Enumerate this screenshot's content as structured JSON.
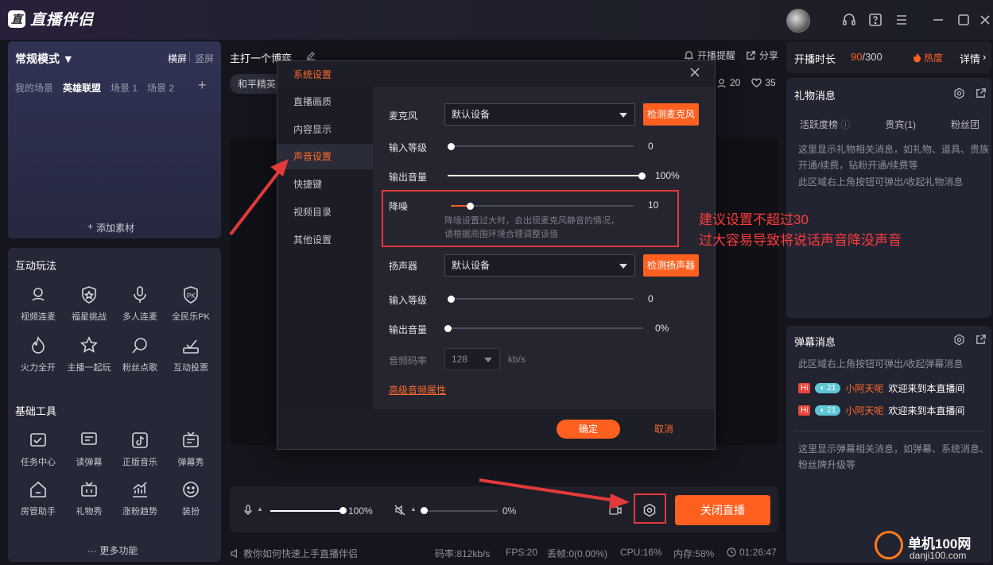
{
  "app": {
    "title": "直播伴侣",
    "logo_mark": "直"
  },
  "left": {
    "mode": "常规模式 ▼",
    "orient_landscape": "横屏",
    "orient_portrait": "竖屏",
    "scene_tabs": [
      "我的场景",
      "英雄联盟",
      "场景 1",
      "场景 2"
    ],
    "add_scene": "+",
    "add_material": "添加素材",
    "interactive_title": "互动玩法",
    "interactive_tools": [
      "视频连麦",
      "福星挑战",
      "多人连麦",
      "全民乐PK",
      "火力全开",
      "主播一起玩",
      "粉丝点歌",
      "互动投票"
    ],
    "basic_title": "基础工具",
    "basic_tools": [
      "任务中心",
      "读弹幕",
      "正版音乐",
      "弹幕秀",
      "房管助手",
      "礼物秀",
      "涨粉趋势",
      "装扮"
    ],
    "more": "··· 更多功能"
  },
  "center": {
    "stream_title": "主打一个博弈",
    "reminder": "开播提醒",
    "share": "分享",
    "tag": "和平精英",
    "viewers": "20",
    "likes": "35",
    "mic_volume": "100%",
    "speaker_volume": "0%",
    "close_live": "关闭直播",
    "status_tip": "教你如何快速上手直播伴侣",
    "bitrate": "码率:812kb/s",
    "fps": "FPS:20",
    "dropped": "丢帧:0(0.00%)",
    "cpu": "CPU:16%",
    "memory": "内存:58%",
    "time": "01:26:47"
  },
  "right": {
    "live_duration_label": "开播时长",
    "heat_value": "90",
    "heat_total": "/300",
    "heat_label": "热度",
    "details": "详情",
    "gift_title": "礼物消息",
    "gift_tabs": [
      "活跃度榜",
      "贵宾(1)",
      "粉丝团"
    ],
    "gift_text": "这里显示礼物相关消息，如礼物、道具、贵族开通/续费，钻粉开通/续费等",
    "gift_hint": "此区域右上角按钮可弹出/收起礼物消息",
    "danmu_title": "弹幕消息",
    "danmu_hint": "此区域右上角按钮可弹出/收起弹幕消息",
    "danmu_msgs": [
      {
        "badge": "Hi",
        "level": "21",
        "user": "小阿天呢",
        "text": "欢迎来到本直播间"
      },
      {
        "badge": "Hi",
        "level": "21",
        "user": "小阿天呢",
        "text": "欢迎来到本直播间"
      }
    ],
    "danmu_text": "这里显示弹幕相关消息，如弹幕、系统消息、粉丝牌升级等"
  },
  "dialog": {
    "title": "系统设置",
    "menu": [
      "直播画质",
      "内容显示",
      "声音设置",
      "快捷键",
      "视频目录",
      "其他设置"
    ],
    "mic_label": "麦克风",
    "mic_device": "默认设备",
    "detect_mic": "检测麦克风",
    "input_level_label": "输入等级",
    "mic_input_level": "0",
    "output_volume_label": "输出音量",
    "mic_output_volume": "100%",
    "noise_label": "降噪",
    "noise_value": "10",
    "noise_hint_1": "降噪设置过大时，会出现麦克风静音的情况，",
    "noise_hint_2": "请根据周围环境合理调整该值",
    "speaker_label": "扬声器",
    "speaker_device": "默认设备",
    "detect_speaker": "检测扬声器",
    "speaker_input_level": "0",
    "speaker_output_volume": "0%",
    "bitrate_label": "音频码率",
    "bitrate_value": "128",
    "bitrate_unit": "kb/s",
    "advanced": "高级音频属性",
    "ok": "确定",
    "cancel": "取消"
  },
  "annotation": {
    "line1": "建议设置不超过30",
    "line2": "过大容易导致将说话声音降没声音"
  },
  "watermark": {
    "name": "单机100网",
    "url": "danji100.com"
  },
  "colors": {
    "accent": "#ff5f1f",
    "annotation": "#ff3b3b"
  }
}
